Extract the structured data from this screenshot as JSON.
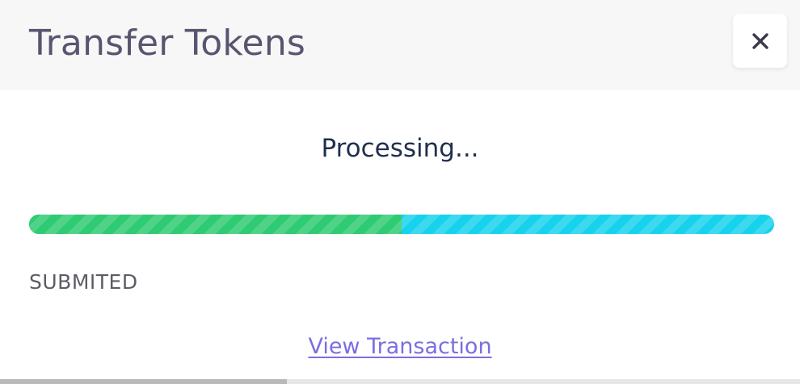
{
  "dialog": {
    "title": "Transfer Tokens",
    "close_icon": "close-icon"
  },
  "status": {
    "heading": "Processing...",
    "label": "SUBMITED",
    "progress_fraction": 0.5,
    "fill_color": "#2ecb72",
    "remaining_color": "#17d2ec"
  },
  "links": {
    "view_transaction": "View Transaction"
  }
}
